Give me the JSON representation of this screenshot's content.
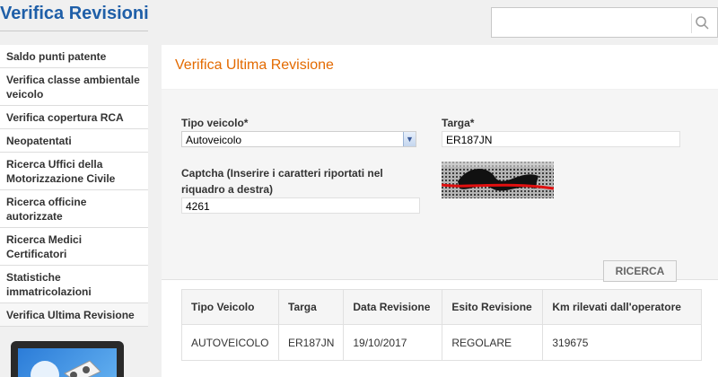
{
  "header": {
    "title": "Verifica Revisioni",
    "search": {
      "value": "",
      "placeholder": ""
    }
  },
  "sidebar": {
    "items": [
      {
        "label": "Saldo punti patente"
      },
      {
        "label": "Verifica classe ambientale veicolo"
      },
      {
        "label": "Verifica copertura RCA"
      },
      {
        "label": "Neopatentati"
      },
      {
        "label": "Ricerca Uffici della Motorizzazione Civile"
      },
      {
        "label": "Ricerca officine autorizzate"
      },
      {
        "label": "Ricerca Medici Certificatori"
      },
      {
        "label": "Statistiche immatricolazioni"
      },
      {
        "label": "Verifica Ultima Revisione"
      }
    ]
  },
  "main": {
    "title": "Verifica Ultima Revisione",
    "form": {
      "vehicle_type_label": "Tipo veicolo*",
      "vehicle_type_value": "Autoveicolo",
      "plate_label": "Targa*",
      "plate_value": "ER187JN",
      "captcha_label": "Captcha (Inserire i caratteri riportati nel riquadro a destra)",
      "captcha_value": "4261",
      "search_button": "RICERCA"
    },
    "table": {
      "headers": [
        "Tipo Veicolo",
        "Targa",
        "Data Revisione",
        "Esito Revisione",
        "Km rilevati dall'operatore"
      ],
      "rows": [
        [
          "AUTOVEICOLO",
          "ER187JN",
          "19/10/2017",
          "REGOLARE",
          "319675"
        ]
      ]
    }
  },
  "colors": {
    "title_blue": "#1f5fa8",
    "section_orange": "#e36a00"
  }
}
